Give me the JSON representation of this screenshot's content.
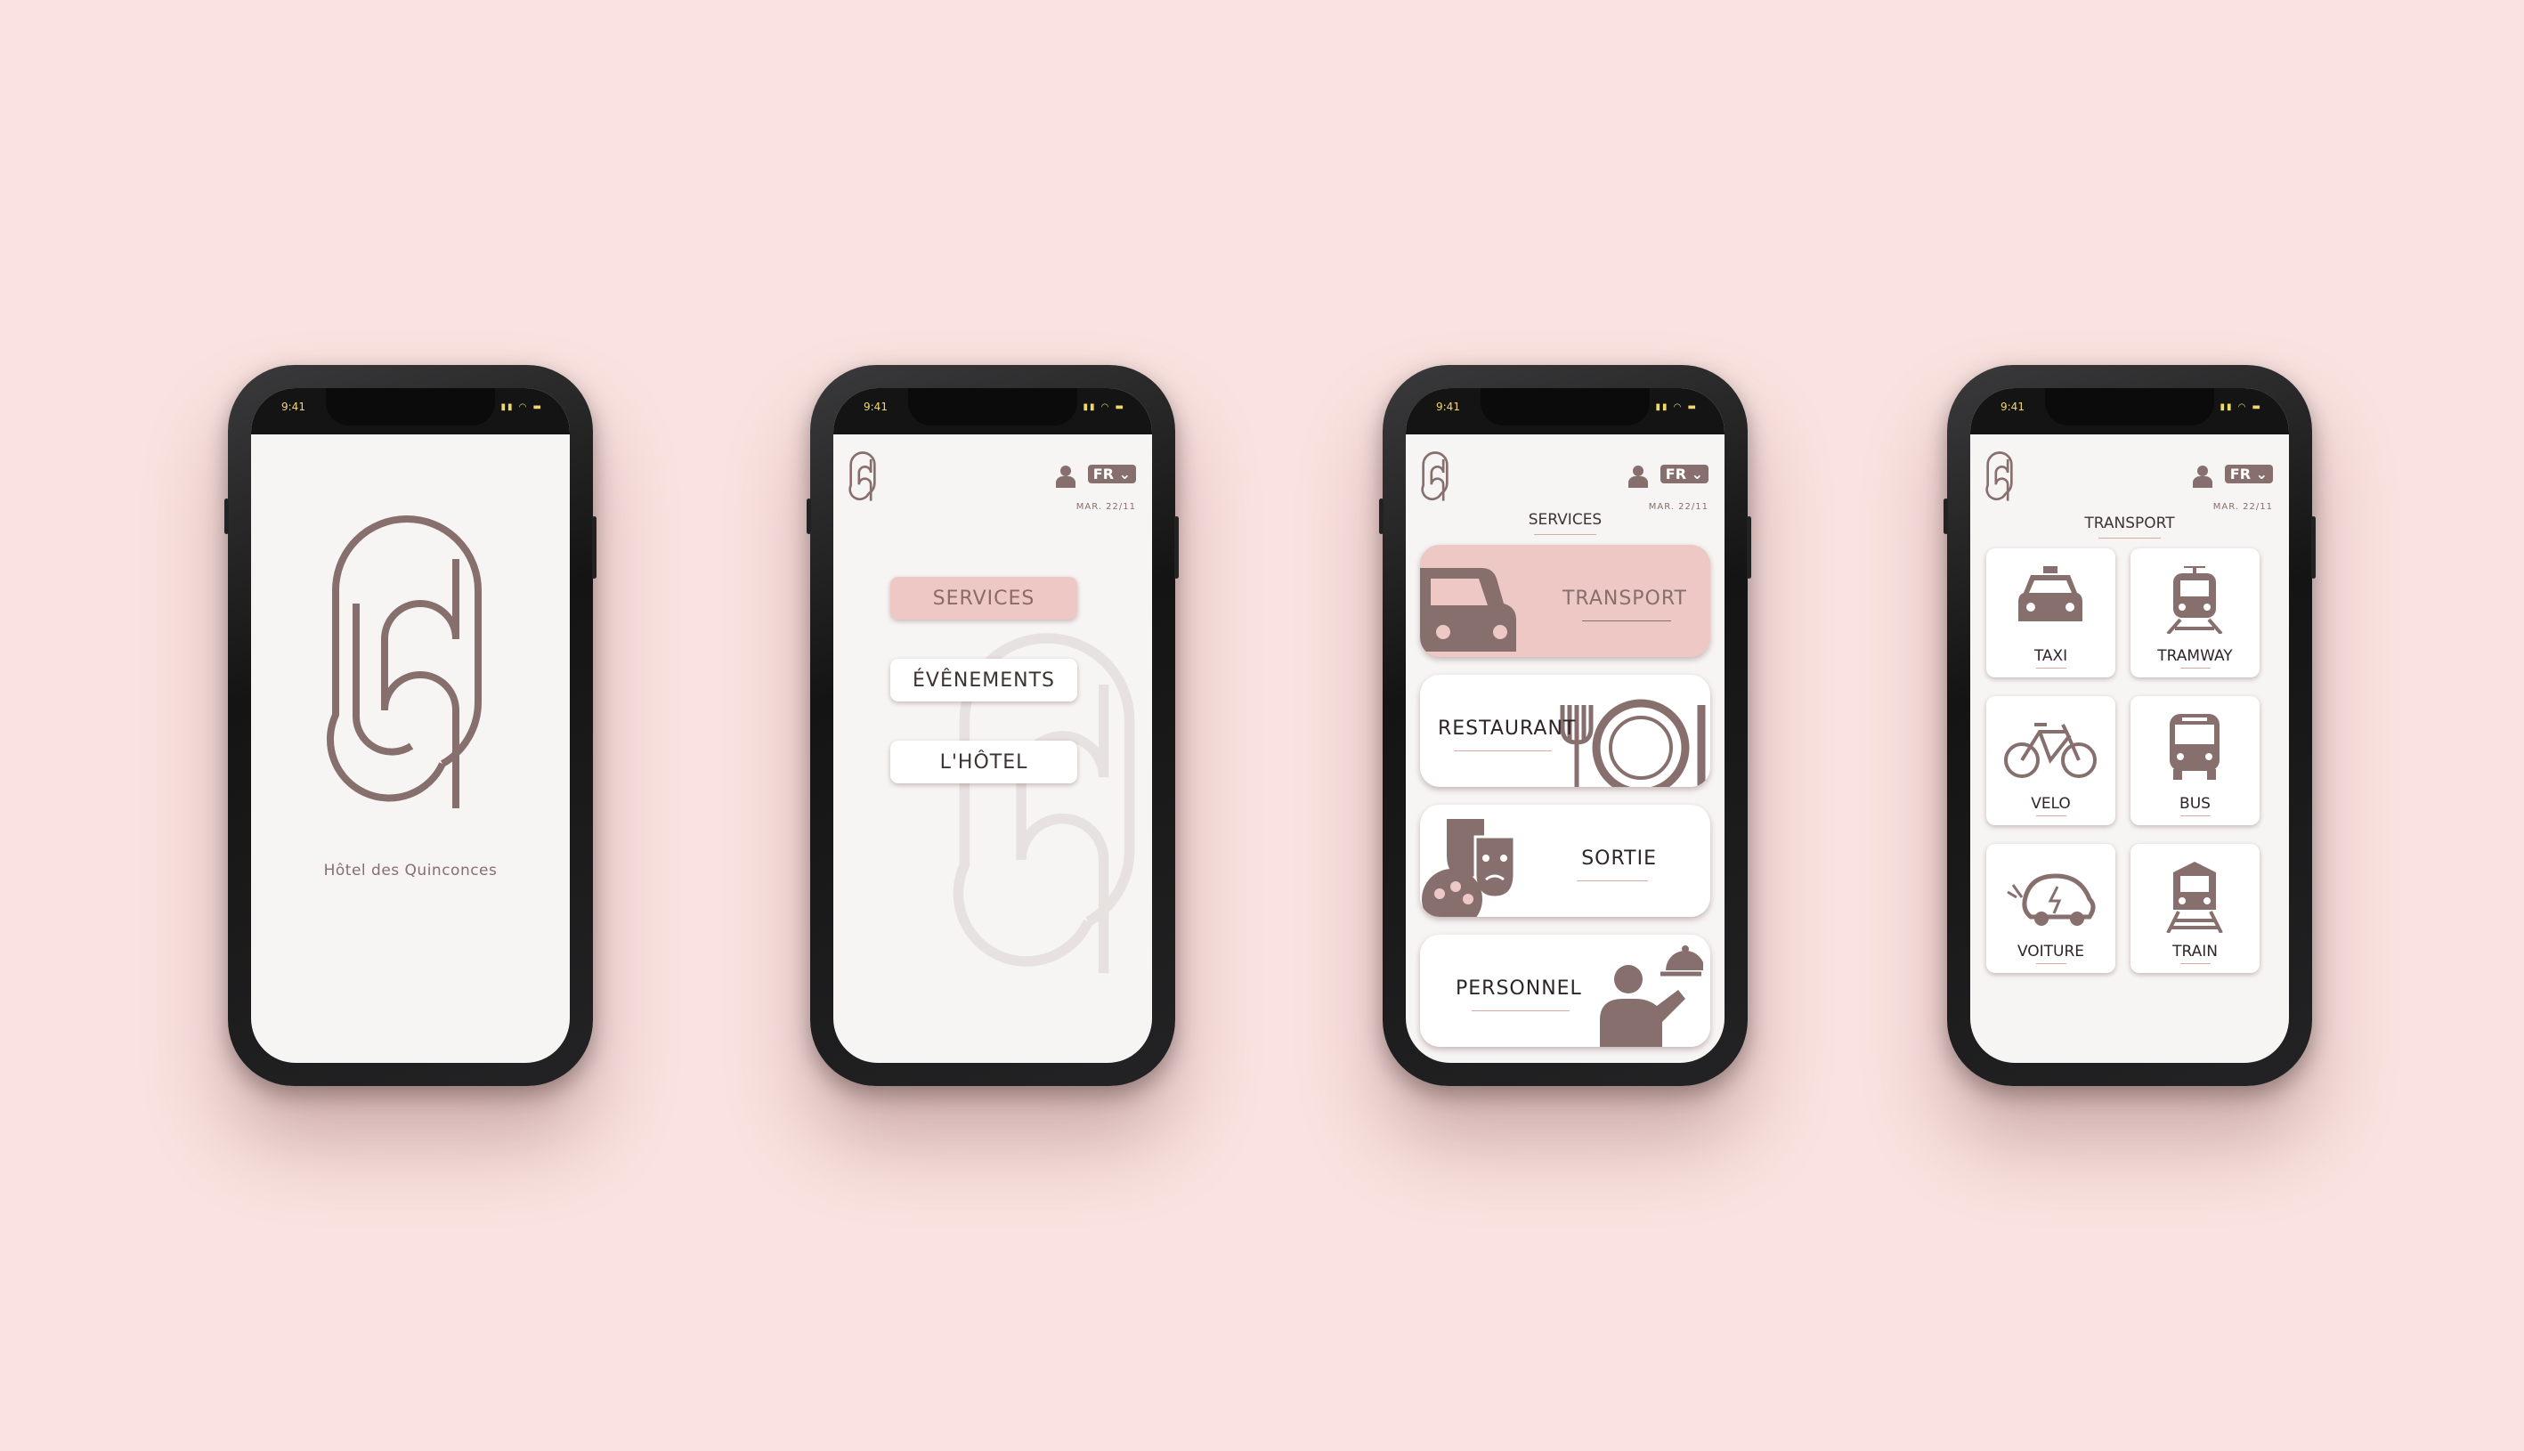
{
  "colors": {
    "background": "#f9e2df",
    "brand": "#866f6d",
    "accent": "#eec8c4",
    "screen": "#f7f5f4"
  },
  "status": {
    "time": "9:41"
  },
  "splash": {
    "hotel_name": "Hôtel des Quinconces"
  },
  "header": {
    "lang": "FR",
    "date": "MAR. 22/11"
  },
  "home": {
    "menu": [
      {
        "label": "SERVICES"
      },
      {
        "label": "ÉVÊNEMENTS"
      },
      {
        "label": "L'HÔTEL"
      }
    ]
  },
  "services": {
    "title": "SERVICES",
    "cards": [
      {
        "label": "TRANSPORT",
        "icon": "car-icon"
      },
      {
        "label": "RESTAURANT",
        "icon": "plate-icon"
      },
      {
        "label": "SORTIE",
        "icon": "theater-masks-icon"
      },
      {
        "label": "PERSONNEL",
        "icon": "waiter-icon"
      }
    ]
  },
  "transport": {
    "title": "TRANSPORT",
    "tiles": [
      {
        "label": "TAXI",
        "icon": "taxi-icon"
      },
      {
        "label": "TRAMWAY",
        "icon": "tram-icon"
      },
      {
        "label": "VELO",
        "icon": "bicycle-icon"
      },
      {
        "label": "BUS",
        "icon": "bus-icon"
      },
      {
        "label": "VOITURE",
        "icon": "electric-car-icon"
      },
      {
        "label": "TRAIN",
        "icon": "train-icon"
      }
    ]
  }
}
